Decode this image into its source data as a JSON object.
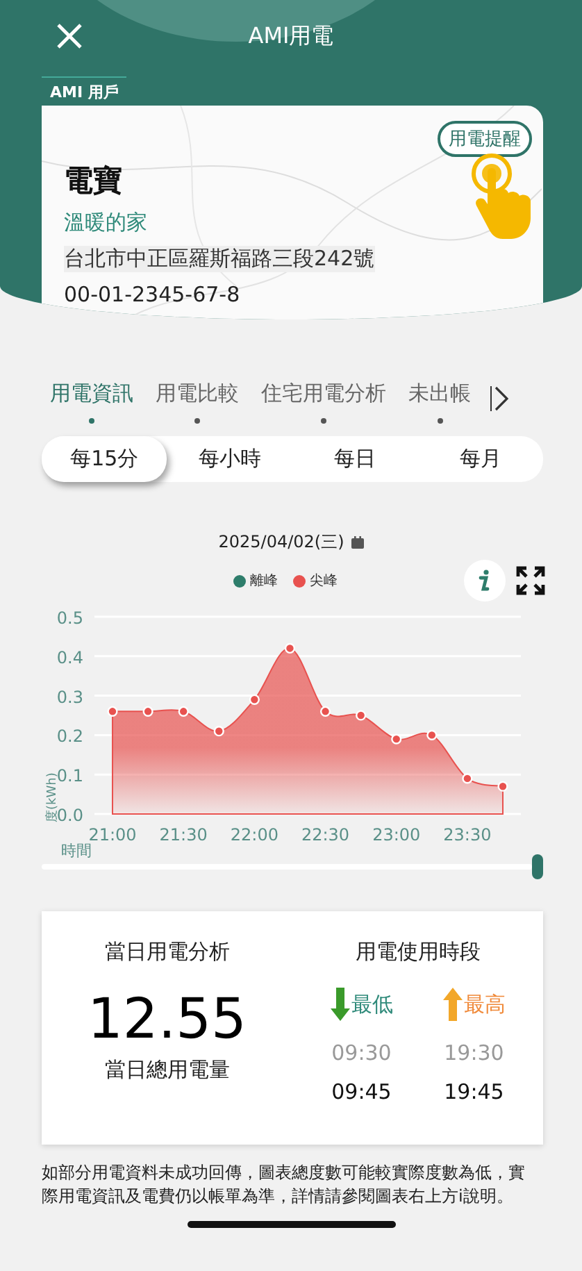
{
  "header": {
    "title": "AMI用電"
  },
  "account": {
    "badge": "AMI 用戶",
    "alert_button": "用電提醒",
    "name": "電寶",
    "nickname": "溫暖的家",
    "address": "台北市中正區羅斯福路三段242號",
    "number": "00-01-2345-67-8"
  },
  "tabs": [
    {
      "label": "用電資訊",
      "selected": true
    },
    {
      "label": "用電比較",
      "selected": false
    },
    {
      "label": "住宅用電分析",
      "selected": false
    },
    {
      "label": "未出帳",
      "selected": false
    }
  ],
  "periods": [
    {
      "label": "每15分",
      "selected": true
    },
    {
      "label": "每小時",
      "selected": false
    },
    {
      "label": "每日",
      "selected": false
    },
    {
      "label": "每月",
      "selected": false
    }
  ],
  "chart": {
    "date": "2025/04/02(三)",
    "chart_data": {
      "type": "area",
      "xlabel": "時間",
      "ylabel": "度(kWh)",
      "grid": true,
      "categories": [
        "21:00",
        null,
        "21:30",
        null,
        "22:00",
        null,
        "22:30",
        null,
        "23:00",
        null,
        "23:30",
        null
      ],
      "series": [
        {
          "name": "離峰",
          "color": "#2e7d6b",
          "values": [
            null,
            null,
            null,
            null,
            null,
            null,
            null,
            null,
            null,
            null,
            null,
            null
          ]
        },
        {
          "name": "尖峰",
          "color": "#e8524f",
          "values": [
            0.26,
            0.26,
            0.26,
            0.21,
            0.29,
            0.42,
            0.26,
            0.25,
            0.19,
            0.2,
            0.09,
            0.07
          ]
        }
      ],
      "ylim": [
        0,
        0.5
      ],
      "yticks": [
        {
          "value": 0,
          "label": "0.0"
        },
        {
          "value": 0.1,
          "label": "0.1"
        },
        {
          "value": 0.2,
          "label": "0.2"
        },
        {
          "value": 0.3,
          "label": "0.3"
        },
        {
          "value": 0.4,
          "label": "0.4"
        },
        {
          "value": 0.5,
          "label": "0.5"
        }
      ]
    },
    "range_slider": {
      "level": 1
    }
  },
  "summary": {
    "title": "當日用電分析",
    "total": "12.55",
    "total_label": "當日總用電量",
    "period_title": "用電使用時段",
    "lowest": {
      "label": "最低",
      "times": [
        "09:30",
        "09:45"
      ]
    },
    "highest": {
      "label": "最高",
      "times": [
        "19:30",
        "19:45"
      ]
    }
  },
  "note": "如部分用電資料未成功回傳，圖表總度數可能較實際度數為低，實際用電資訊及電費仍以帳單為準，詳情請參閱圖表右上方i說明。"
}
